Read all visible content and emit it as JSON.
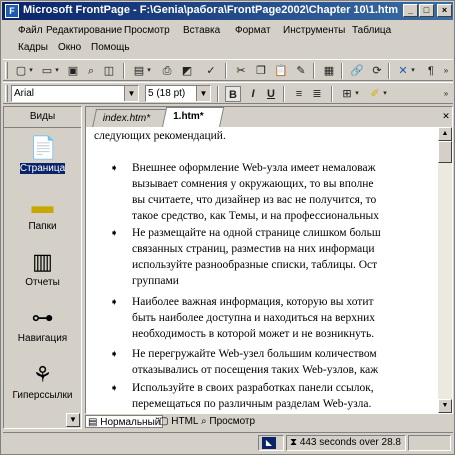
{
  "window": {
    "title": "Microsoft FrontPage - F:\\Genia\\рабога\\FrontPage2002\\Chapter 10\\1.htm",
    "minimize": "_",
    "restore": "□",
    "close": "×"
  },
  "menu": [
    "Файл",
    "Редактирование",
    "Просмотр",
    "Вставка",
    "Формат",
    "Инструменты",
    "Таблица",
    "Кадры",
    "Окно",
    "Помощь"
  ],
  "format_toolbar": {
    "font": "Arial",
    "size": "5 (18 pt)",
    "bold": "B",
    "italic": "I",
    "underline": "U"
  },
  "views_panel": {
    "header": "Виды",
    "items": [
      {
        "label": "Страница",
        "icon": "page-icon"
      },
      {
        "label": "Папки",
        "icon": "folder-icon"
      },
      {
        "label": "Отчеты",
        "icon": "reports-icon"
      },
      {
        "label": "Навигация",
        "icon": "navigation-icon"
      },
      {
        "label": "Гиперссылки",
        "icon": "hyperlinks-icon"
      }
    ]
  },
  "tabs": [
    "index.htm*",
    "1.htm*"
  ],
  "document": {
    "intro": "следующих рекомендаций.",
    "bullets": [
      [
        "Внешнее оформление Web-узла имеет немаловаж",
        "вызывает сомнения у окружающих, то вы вполне",
        "вы считаете, что дизайнер из вас не получится, то",
        "такое средство, как Темы, и на профессиональных"
      ],
      [
        "Не размещайте на одной странице слишком больш",
        "связанных страниц, разместив на них информаци",
        "используйте разнообразные списки, таблицы. Ост",
        "группами"
      ],
      [
        "Наиболее важная информация, которую вы хотит",
        "быть наиболее доступна и находиться на верхних",
        "необходимость в которой может и не возникнуть."
      ],
      [
        "Не перегружайте Web-узел большим количеством",
        "отказывались от посещения таких Web-узлов, каж"
      ],
      [
        "Используйте в своих разработках панели ссылок,",
        "перемещаться по различным разделам Web-узла."
      ]
    ]
  },
  "viewbar": {
    "normal": "Нормальный",
    "html": "HTML",
    "preview": "Просмотр"
  },
  "status": {
    "download": "443 seconds over 28.8"
  }
}
